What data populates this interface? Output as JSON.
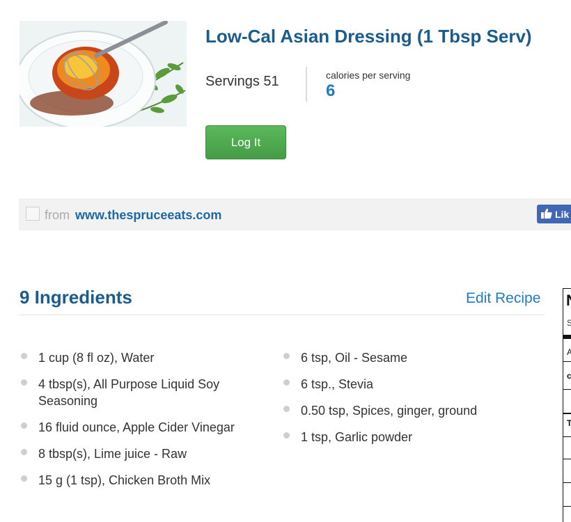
{
  "recipe": {
    "title": "Low-Cal Asian Dressing (1 Tbsp Serv)",
    "servings_label": "Servings 51",
    "calories_label": "calories per serving",
    "calories_value": "6",
    "log_button": "Log It"
  },
  "source": {
    "from_label": "from",
    "link_text": "www.thespruceeats.com",
    "like_button": "Lik"
  },
  "ingredients": {
    "heading": "9 Ingredients",
    "edit_label": "Edit Recipe",
    "column1": [
      "1 cup (8 fl oz), Water",
      "4 tbsp(s), All Purpose Liquid Soy Seasoning",
      "16 fluid ounce, Apple Cider Vinegar",
      "8 tbsp(s), Lime juice - Raw",
      "15 g (1 tsp), Chicken Broth Mix"
    ],
    "column2": [
      "6 tsp, Oil - Sesame",
      "6 tsp., Stevia",
      "0.50 tsp, Spices, ginger, ground",
      "1 tsp, Garlic powder"
    ]
  },
  "nutrition_panel": {
    "header_letter": "N",
    "sub_letter": "S",
    "row_a": "A",
    "row_c": "c",
    "row_t": "T"
  },
  "colors": {
    "title": "#1a5c8e",
    "link": "#1f7bc4",
    "button_green": "#5cb85c",
    "facebook": "#4267b2"
  }
}
